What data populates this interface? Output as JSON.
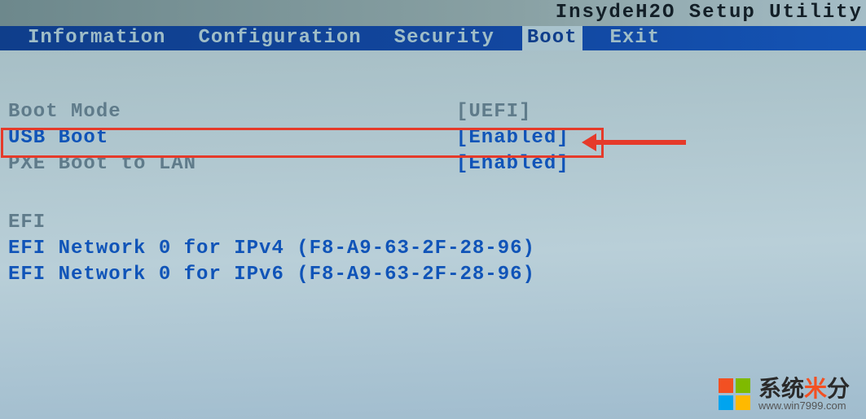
{
  "title": "InsydeH2O Setup Utility",
  "menu": {
    "items": [
      {
        "label": "Information",
        "active": false
      },
      {
        "label": "Configuration",
        "active": false
      },
      {
        "label": "Security",
        "active": false
      },
      {
        "label": "Boot",
        "active": true
      },
      {
        "label": "Exit",
        "active": false
      }
    ]
  },
  "settings": {
    "boot_mode": {
      "label": "Boot Mode",
      "value": "[UEFI]"
    },
    "usb_boot": {
      "label": "USB Boot",
      "value": "[Enabled]"
    },
    "pxe_boot": {
      "label": "PXE Boot to LAN",
      "value": "[Enabled]"
    }
  },
  "efi": {
    "heading": "EFI",
    "entries": [
      "EFI Network 0 for IPv4 (F8-A9-63-2F-28-96)",
      "EFI Network 0 for IPv6 (F8-A9-63-2F-28-96)"
    ]
  },
  "watermark": {
    "brand_a": "系统",
    "brand_star": "米",
    "brand_b": "分",
    "url": "www.win7999.com"
  },
  "annotation": {
    "highlight_target": "usb_boot"
  }
}
